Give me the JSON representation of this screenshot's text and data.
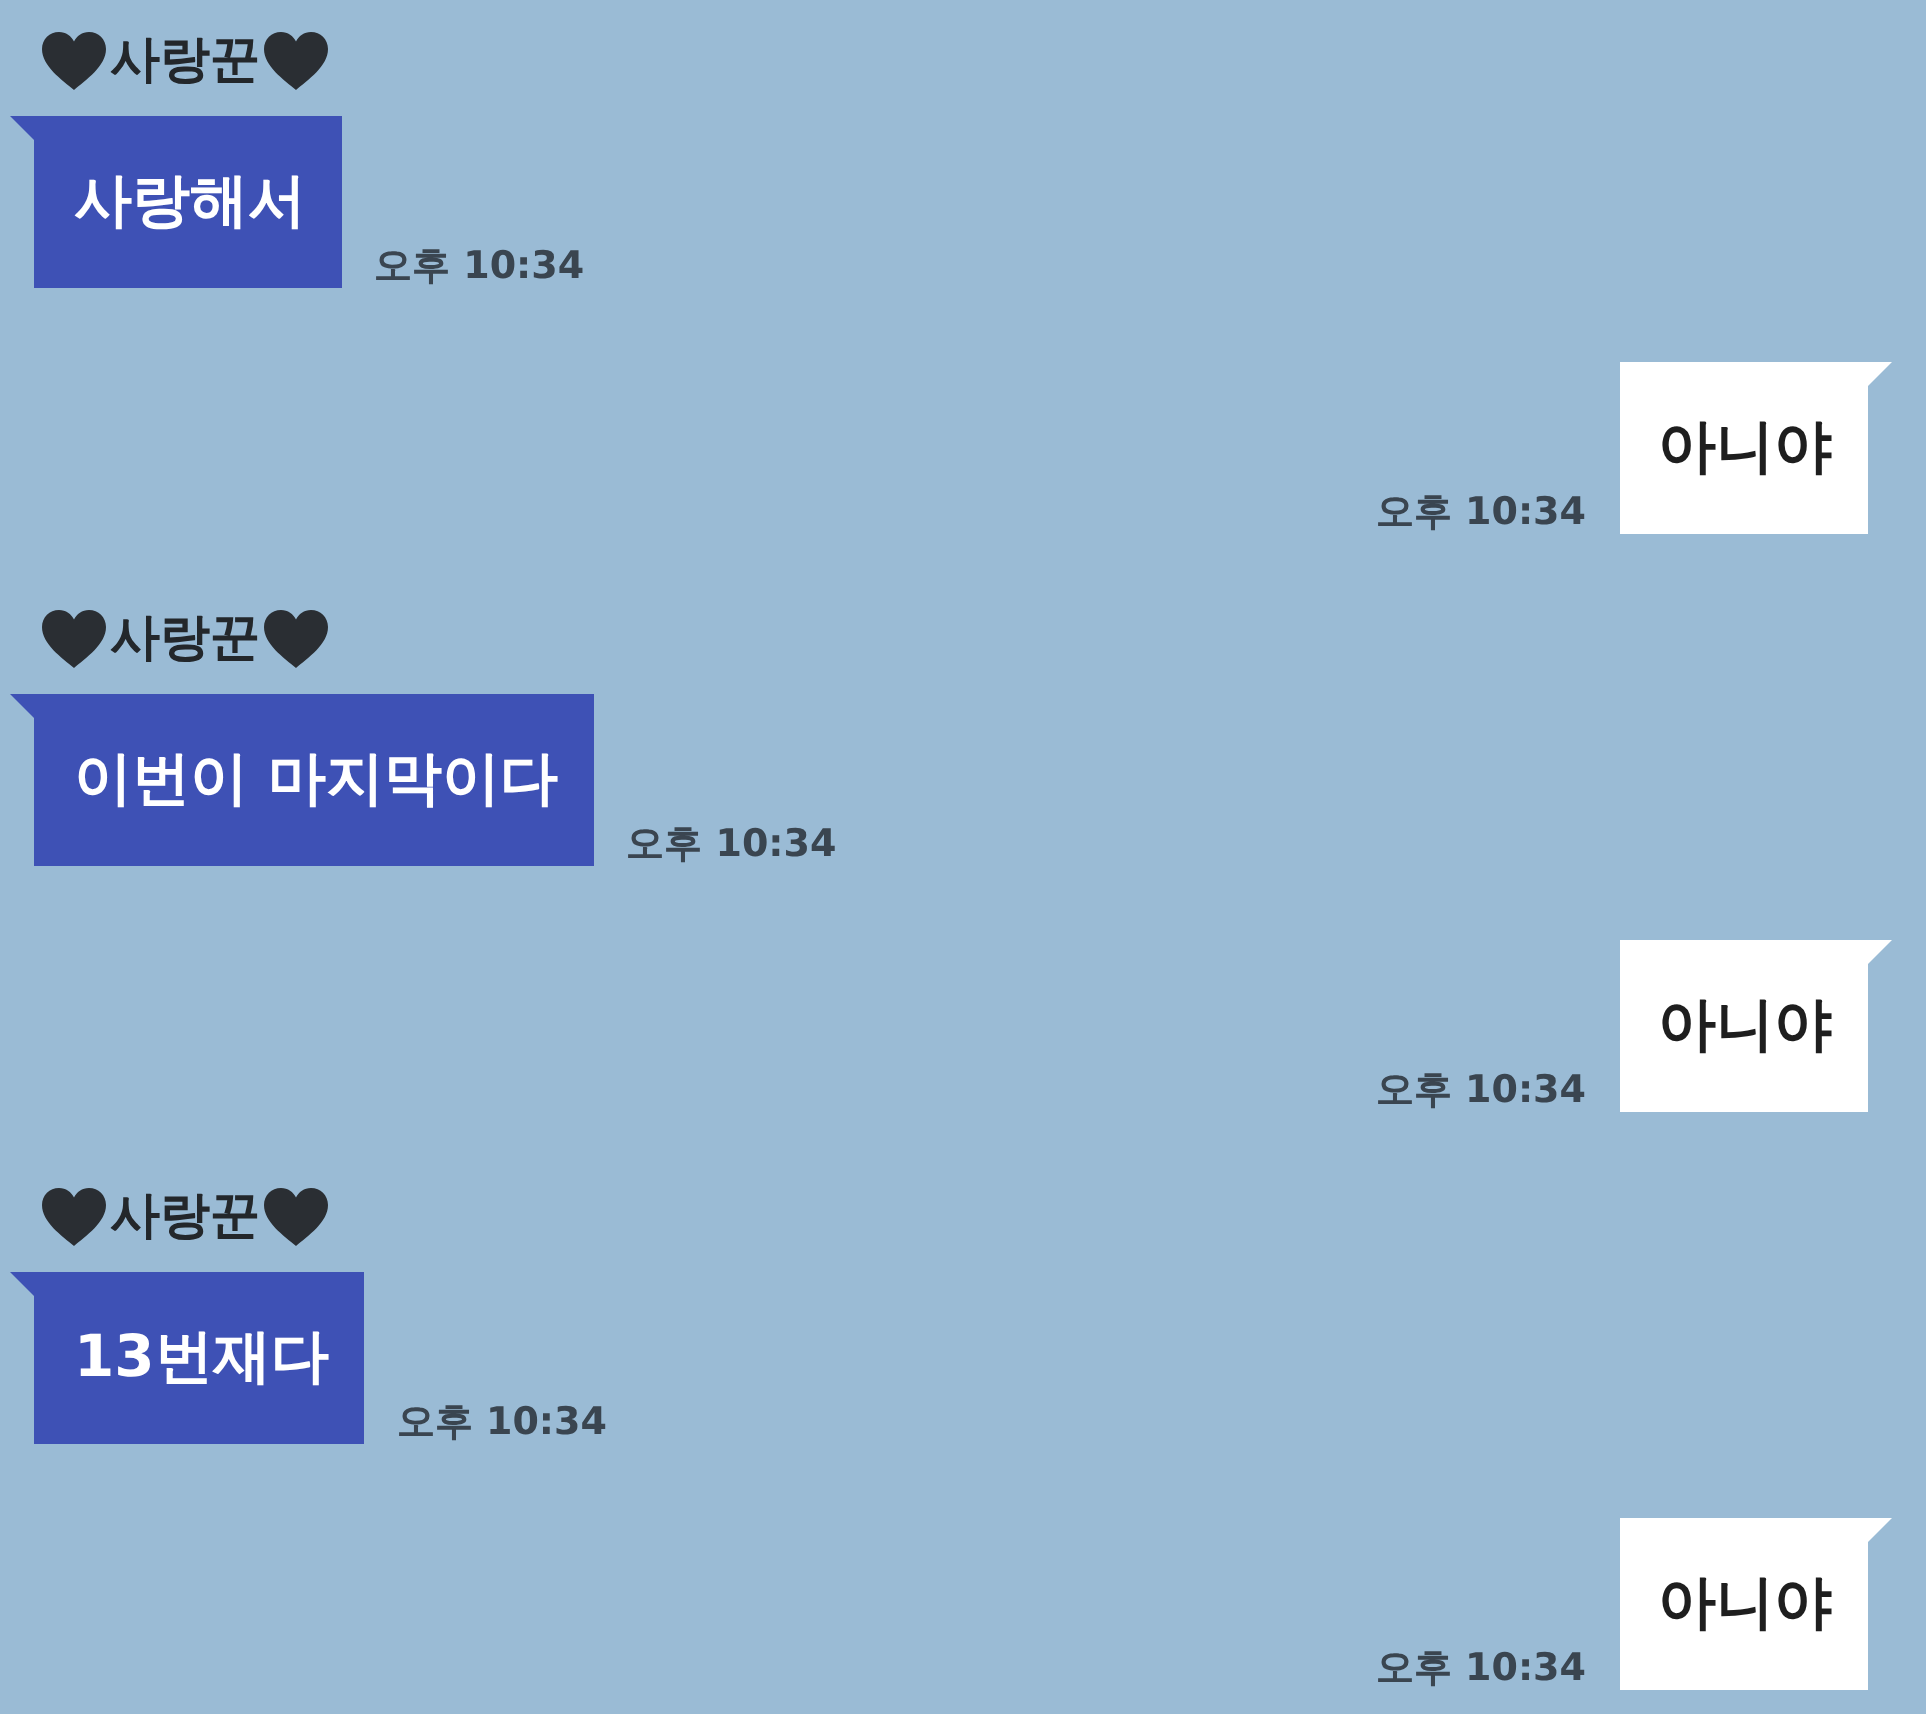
{
  "messages": [
    {
      "kind": "incoming",
      "sender": "사랑꾼",
      "text": "사랑해서",
      "time": "오후 10:34"
    },
    {
      "kind": "outgoing",
      "text": "아니야",
      "time": "오후 10:34"
    },
    {
      "kind": "incoming",
      "sender": "사랑꾼",
      "text": "이번이 마지막이다",
      "time": "오후 10:34"
    },
    {
      "kind": "outgoing",
      "text": "아니야",
      "time": "오후 10:34"
    },
    {
      "kind": "incoming",
      "sender": "사랑꾼",
      "text": "13번재다",
      "time": "오후 10:34"
    },
    {
      "kind": "outgoing",
      "text": "아니야",
      "time": "오후 10:34"
    }
  ]
}
